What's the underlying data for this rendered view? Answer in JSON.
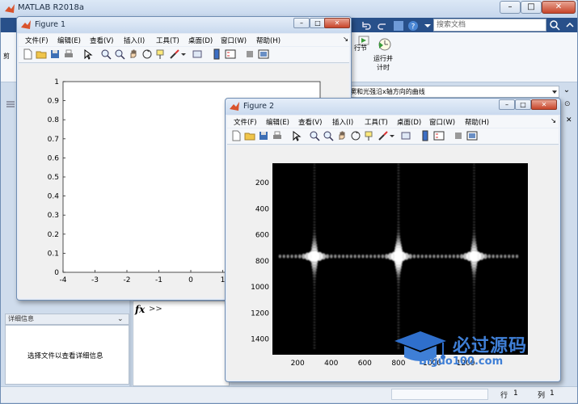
{
  "main_window": {
    "title": "MATLAB R2018a",
    "search_placeholder": "搜索文档",
    "ribbon_btn_run_section": "行节",
    "ribbon_btn_run_time_line1": "运行并",
    "ribbon_btn_run_time_line2": "计时",
    "path_text": "窦和光强沿x轴方向的曲线",
    "details_header": "详细信息",
    "details_message": "选择文件以查看详细信息",
    "command_prompt": ">>",
    "fx_label": "fx",
    "status_row_label": "行",
    "status_row_value": "1",
    "status_col_label": "列",
    "status_col_value": "1"
  },
  "figure_menu": [
    "文件(F)",
    "编辑(E)",
    "查看(V)",
    "插入(I)",
    "工具(T)",
    "桌面(D)",
    "窗口(W)",
    "帮助(H)"
  ],
  "figure1": {
    "title": "Figure 1",
    "y_ticks": [
      "0",
      "0.1",
      "0.2",
      "0.3",
      "0.4",
      "0.5",
      "0.6",
      "0.7",
      "0.8",
      "0.9",
      "1"
    ],
    "x_ticks": [
      "-4",
      "-3",
      "-2",
      "-1",
      "0",
      "1"
    ]
  },
  "figure2": {
    "title": "Figure 2",
    "y_ticks": [
      "200",
      "400",
      "600",
      "800",
      "1000",
      "1200",
      "1400"
    ],
    "x_ticks": [
      "200",
      "400",
      "600",
      "800",
      "1000",
      "1200"
    ]
  },
  "watermark": {
    "text": "必过源码",
    "url": "Biguo100.com"
  },
  "colors": {
    "accent": "#28508a",
    "watermark": "#3f7fd6"
  }
}
